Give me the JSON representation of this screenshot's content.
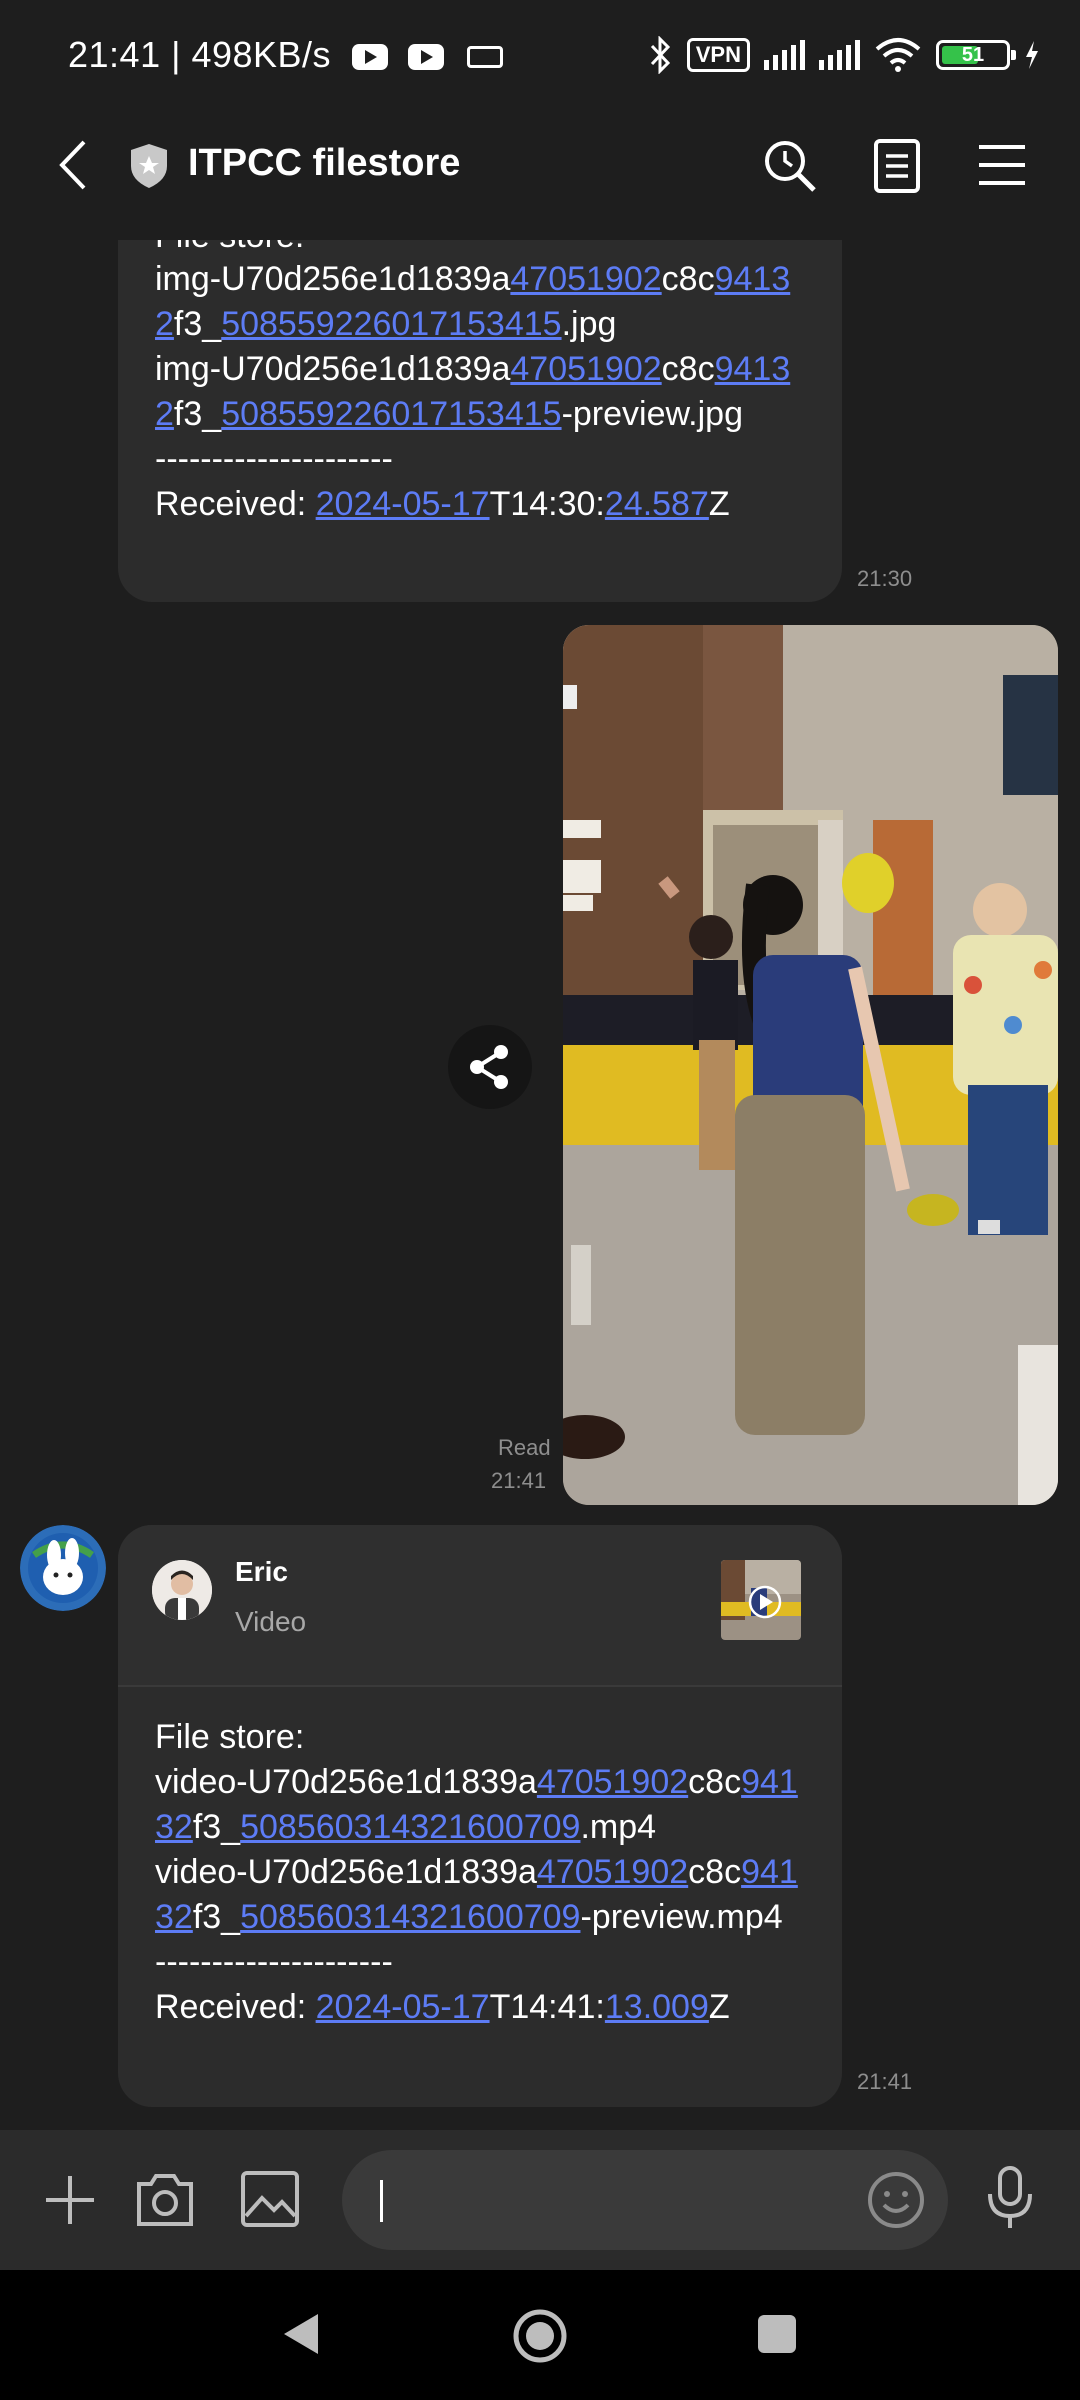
{
  "status_bar": {
    "time": "21:41",
    "net_speed": "498KB/s",
    "vpn": "VPN",
    "battery": "51"
  },
  "header": {
    "title": "ITPCC filestore"
  },
  "messages": {
    "m1": {
      "line0": "File store:",
      "time": "21:30"
    },
    "photo": {
      "read": "Read",
      "time": "21:41"
    },
    "m2": {
      "sender": "Eric",
      "type": "Video",
      "time": "21:41"
    }
  },
  "colors": {
    "background": "#1e1e1e",
    "bubble": "#2c2c2c",
    "link": "#5d7cf5",
    "battery_fill": "#35c24a"
  },
  "icons": [
    "back-icon",
    "shield-icon",
    "search-icon",
    "notes-icon",
    "menu-icon",
    "share-icon",
    "plus-icon",
    "camera-icon",
    "image-icon",
    "emoji-icon",
    "mic-icon",
    "nav-back-icon",
    "nav-home-icon",
    "nav-recents-icon"
  ]
}
